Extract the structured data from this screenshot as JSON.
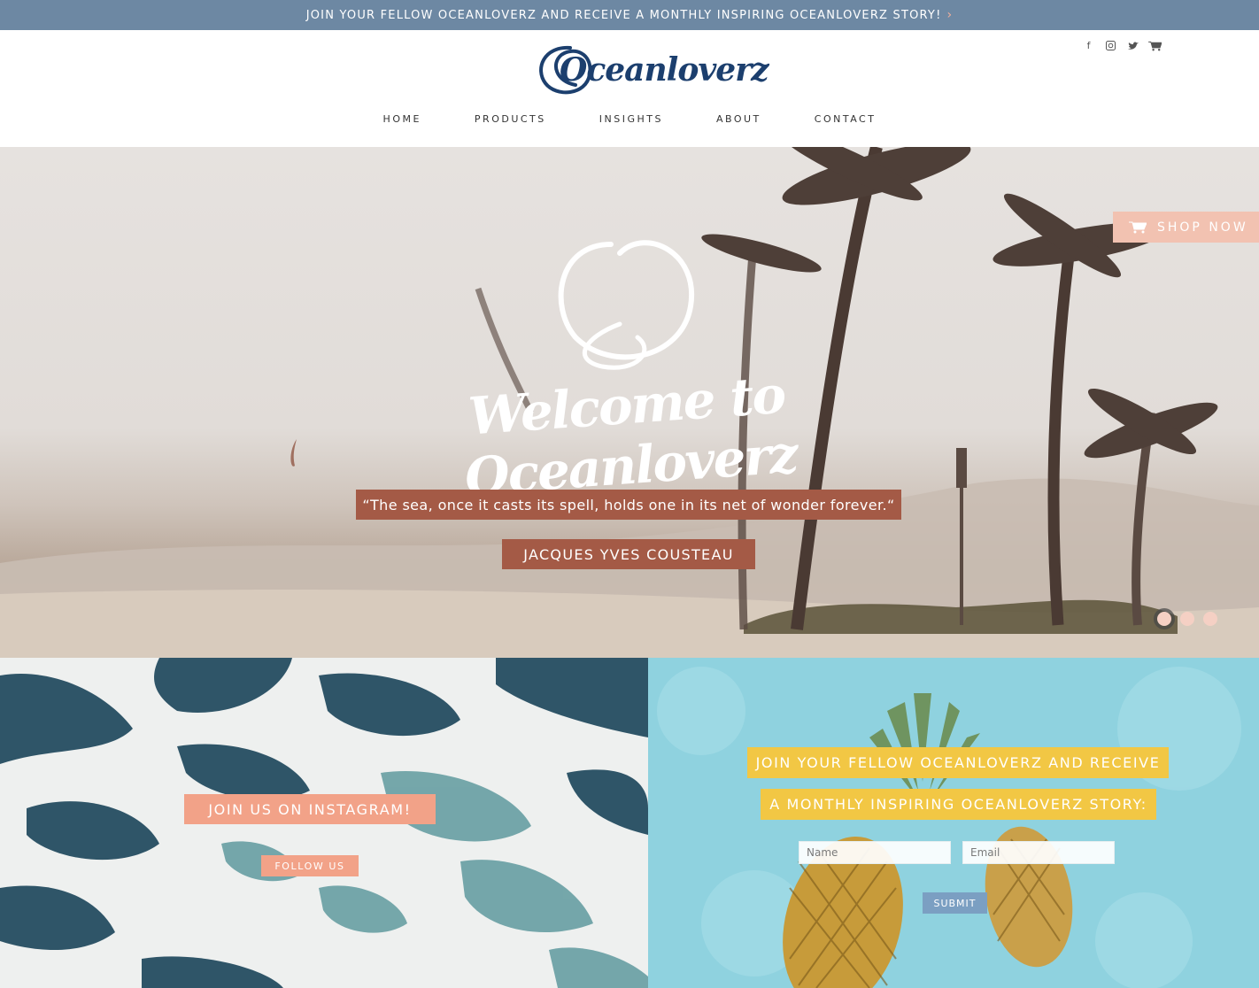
{
  "announcement": {
    "text": "JOIN YOUR FELLOW OCEANLOVERZ AND RECEIVE A MONTHLY INSPIRING OCEANLOVERZ STORY!",
    "arrow": "›"
  },
  "header": {
    "logo_text": "Oceanloverz",
    "social_icons": [
      "facebook-icon",
      "instagram-icon",
      "twitter-icon",
      "cart-icon"
    ],
    "nav": [
      "HOME",
      "PRODUCTS",
      "INSIGHTS",
      "ABOUT",
      "CONTACT"
    ]
  },
  "hero": {
    "shop_now": "SHOP NOW",
    "welcome": "Welcome to Oceanloverz",
    "quote": "“The sea, once it casts its spell, holds one in its net of wonder forever.“",
    "author": "JACQUES YVES COUSTEAU",
    "slides": 3,
    "active_slide": 1
  },
  "instagram": {
    "title": "JOIN US ON INSTAGRAM!",
    "button": "FOLLOW US"
  },
  "newsletter": {
    "line1": "JOIN YOUR FELLOW OCEANLOVERZ AND RECEIVE",
    "line2": "A MONTHLY INSPIRING OCEANLOVERZ STORY:",
    "name_placeholder": "Name",
    "email_placeholder": "Email",
    "submit": "SUBMIT"
  },
  "colors": {
    "topbar": "#6d88a3",
    "navy": "#1c3f6e",
    "rust": "#a45a46",
    "peach": "#f2a288",
    "yellow": "#f2c744",
    "blue_btn": "#7b9fc2"
  }
}
